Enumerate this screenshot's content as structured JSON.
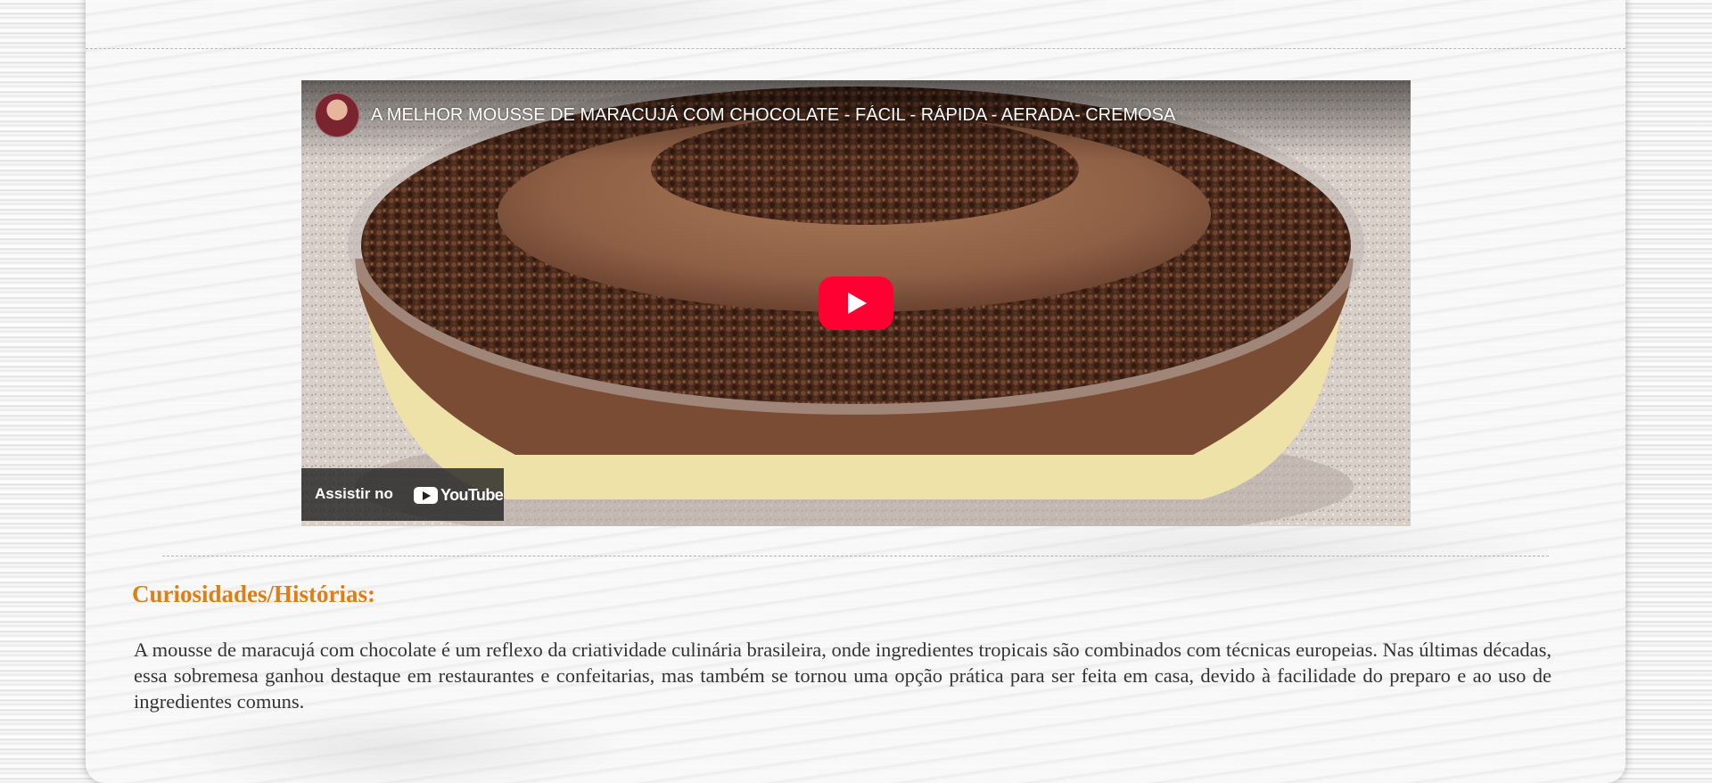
{
  "video": {
    "title": "A MELHOR MOUSSE DE MARACUJÁ COM CHOCOLATE - FÁCIL - RÁPIDA - AERADA- CREMOSA",
    "watch_on_label": "Assistir no",
    "platform_name": "YouTube",
    "play_button_color": "#ff0033"
  },
  "section": {
    "heading": "Curiosidades/Histórias:",
    "heading_color": "#e07e14",
    "paragraph": "A mousse de maracujá com chocolate é um reflexo da criatividade culinária brasileira, onde ingredientes tropicais são combinados com técnicas europeias. Nas últimas décadas, essa sobremesa ganhou destaque em restaurantes e confeitarias, mas também se tornou uma opção prática para ser feita em casa, devido à facilidade do preparo e ao uso de ingredientes comuns."
  }
}
